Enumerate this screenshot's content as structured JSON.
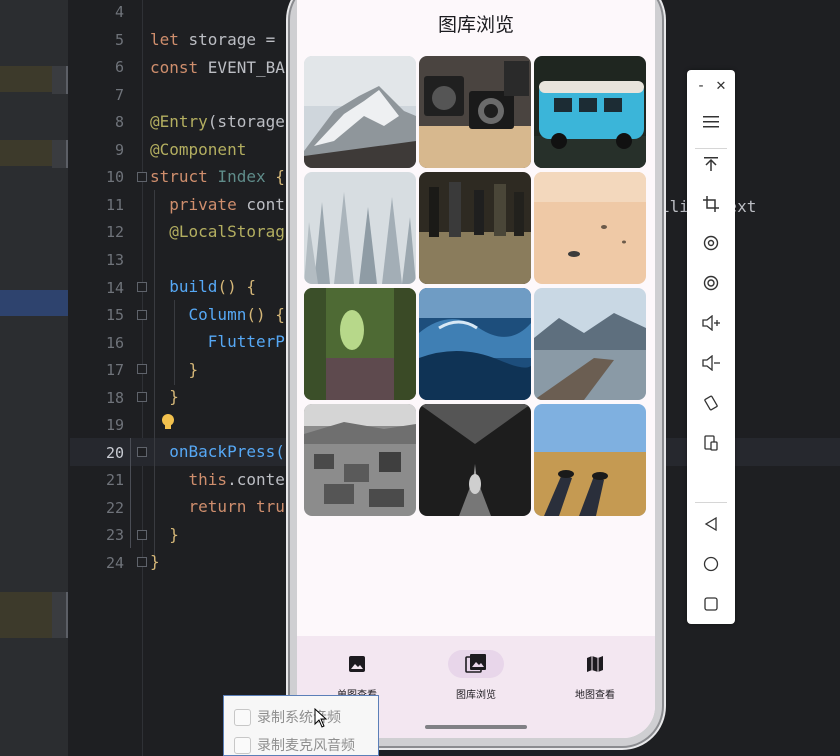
{
  "editor": {
    "line_numbers": [
      "4",
      "5",
      "6",
      "7",
      "8",
      "9",
      "10",
      "11",
      "12",
      "13",
      "14",
      "15",
      "16",
      "17",
      "18",
      "19",
      "20",
      "21",
      "22",
      "23",
      "24"
    ],
    "current_line": "20",
    "lines": {
      "l5a": "let ",
      "l5b": "storage =",
      "l6a": "const ",
      "l6b": "EVENT_BA",
      "l8a": "@Entry",
      "l8b": "(storage",
      "l9": "@Component",
      "l10a": "struct ",
      "l10b": "Index ",
      "l10c": "{",
      "l11a": "  private ",
      "l11b": "cont",
      "l12": "  @LocalStorag",
      "l14a": "  build",
      "l14b": "() {",
      "l15a": "    Column",
      "l15b": "() {",
      "l16": "      FlutterP",
      "l17": "    }",
      "l18": "  }",
      "l20": "  onBackPress(",
      "l21a": "    this",
      "l21b": ".conte",
      "l22a": "    return ",
      "l22b": "tru",
      "l23": "  }",
      "l24": "}"
    },
    "right_overflow_text": "ilit ntext"
  },
  "app": {
    "title": "图库浏览",
    "nav": [
      {
        "label": "单图查看",
        "icon": "image-icon"
      },
      {
        "label": "图库浏览",
        "icon": "gallery-icon",
        "active": true
      },
      {
        "label": "地图查看",
        "icon": "map-icon"
      }
    ],
    "photos": [
      "snowy-mountain",
      "vintage-cameras",
      "blue-vw-van",
      "frosted-forest",
      "subway-crowd",
      "desert-sand",
      "green-forest-tunnel",
      "ocean-wave",
      "wooden-pier-lake",
      "bw-city-aerial",
      "bw-tree-path",
      "legs-in-field"
    ]
  },
  "toolbar": {
    "buttons": [
      "minimize-icon",
      "close-icon",
      "menu-icon",
      "pin-top-icon",
      "crop-icon",
      "rotate-icon",
      "screenshot-icon",
      "volume-up-icon",
      "volume-down-icon",
      "rotate-device-icon",
      "multi-device-icon",
      "back-icon",
      "home-icon",
      "recents-icon"
    ],
    "minimize_glyph": "-",
    "close_glyph": "✕"
  },
  "recording": {
    "system_audio_label": "录制系统音频",
    "mic_audio_label": "录制麦克风音频"
  },
  "colors": {
    "nav_bg": "#f3e7f1",
    "nav_active_pill": "#e8d6ea",
    "screen_bg": "#fdf8fb"
  }
}
